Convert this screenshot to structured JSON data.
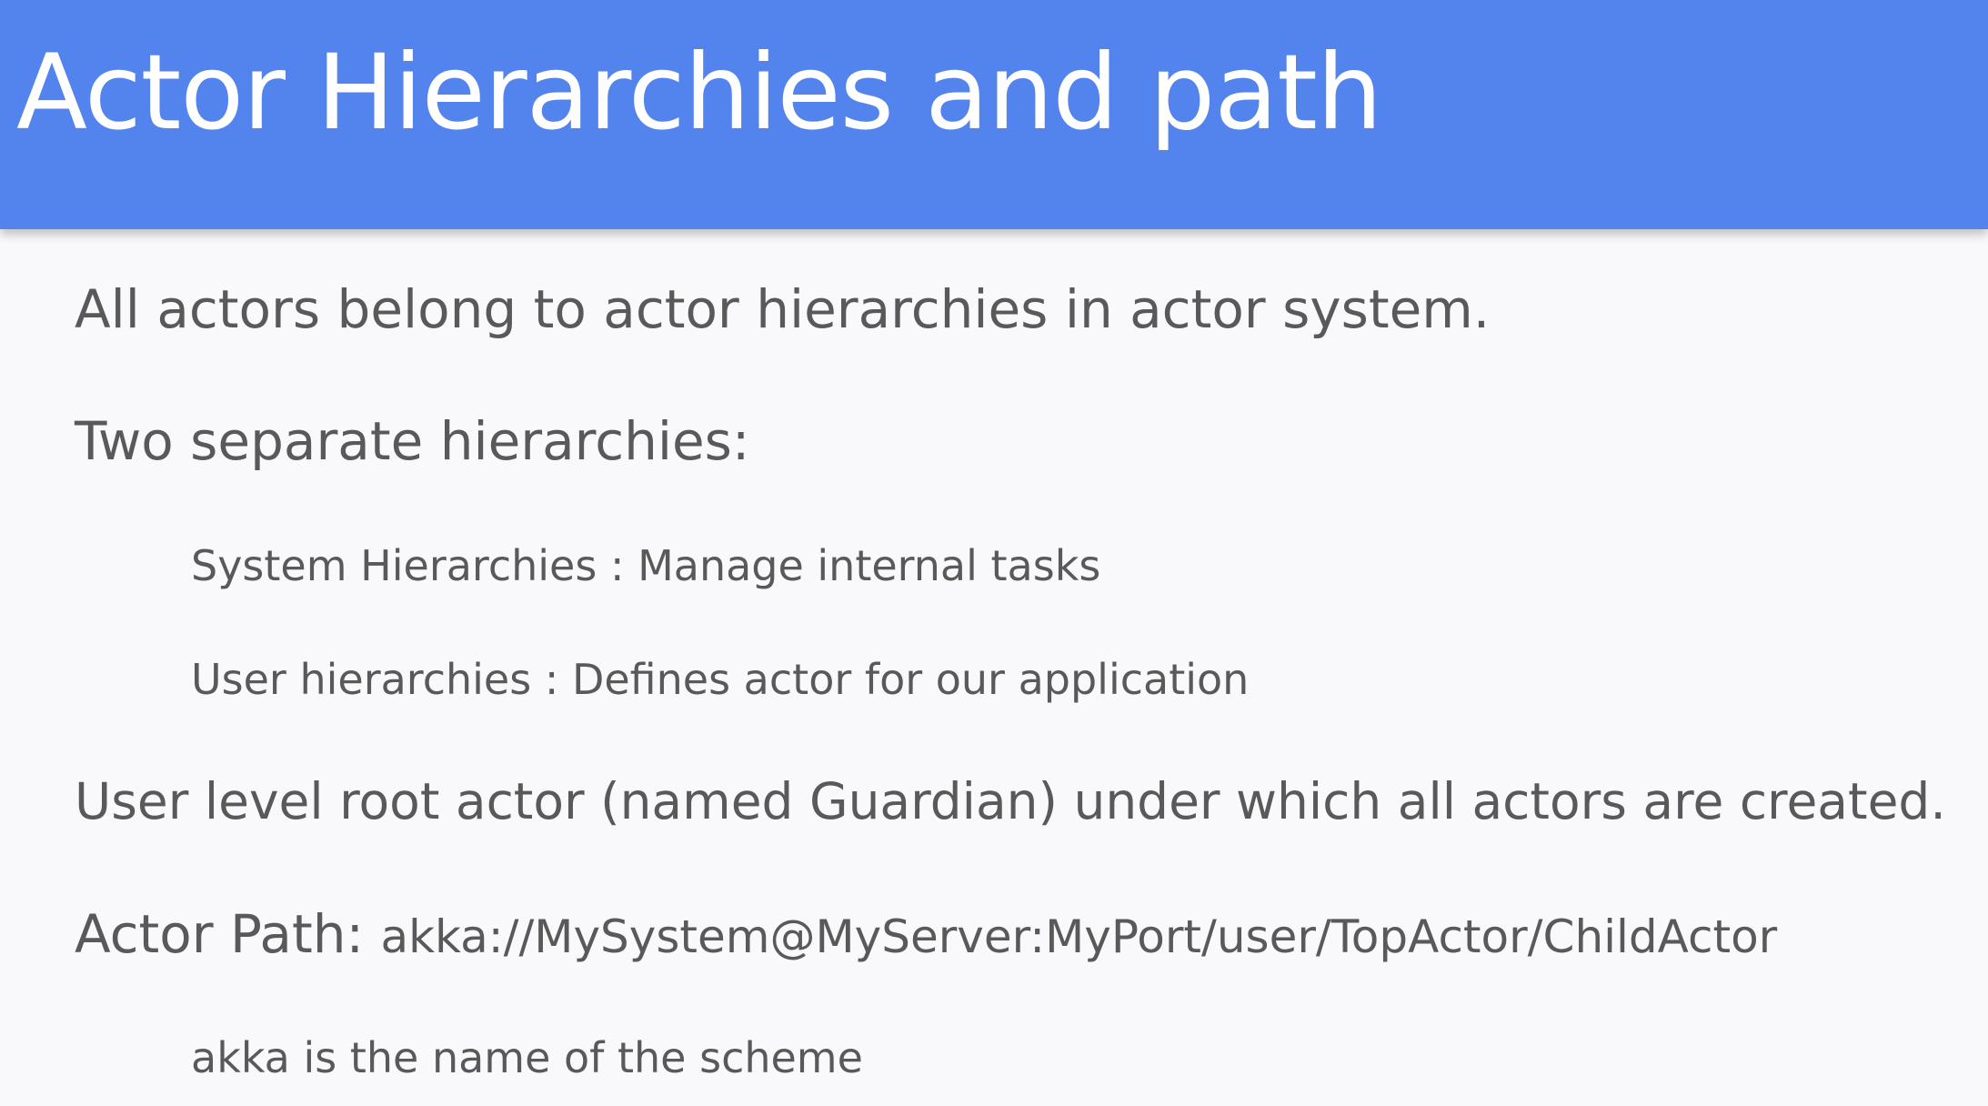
{
  "slide": {
    "title": "Actor Hierarchies and path",
    "bullets": [
      "All actors belong to actor hierarchies in actor system.",
      "Two separate hierarchies:",
      "System Hierarchies : Manage internal tasks",
      "User hierarchies : Defines actor for our application",
      "User level root actor (named Guardian) under which all actors are created.",
      "akka is the name of the scheme"
    ],
    "actor_path": {
      "label": "Actor Path:",
      "value": "akka://MySystem@MyServer:MyPort/user/TopActor/ChildActor"
    }
  },
  "colors": {
    "title_bar": "#5383ec",
    "title_text": "#ffffff",
    "body_text": "#595959",
    "background": "#f9f8fb"
  }
}
